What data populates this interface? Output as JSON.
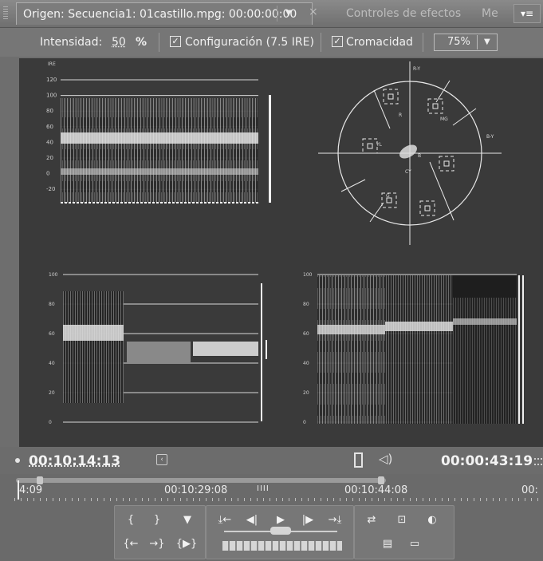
{
  "tabs": {
    "source": "Origen: Secuencia1: 01castillo.mpg: 00:00:00:00",
    "effects": "Controles de efectos",
    "meta": "Me",
    "dropdown_glyph": "▼",
    "close_glyph": "×",
    "panel_menu_glyph": "▾≡"
  },
  "options": {
    "intensity_label": "Intensidad:",
    "intensity_value": "50",
    "intensity_unit": "%",
    "setup_label": "Configuración (7.5 IRE)",
    "setup_checked": true,
    "chroma_label": "Cromacidad",
    "chroma_checked": true,
    "zoom_value": "75%"
  },
  "scopes": {
    "waveform_axis_title": "IRE",
    "waveform_ticks": [
      "120",
      "100",
      "80",
      "60",
      "40",
      "20",
      "0",
      "-20"
    ],
    "vector_labels": {
      "ry": "R-Y",
      "by": "B-Y",
      "r": "R",
      "mg": "MG",
      "yl": "YL",
      "g": "G",
      "cy": "CY",
      "b": "B"
    },
    "parade_ticks": [
      "100",
      "80",
      "60",
      "40",
      "20",
      "0"
    ]
  },
  "timecode": {
    "current": "00:10:14:13",
    "duration": "00:00:43:19"
  },
  "ruler": {
    "labels": [
      "4:09",
      "00:10:29:08",
      "00:10:44:08",
      "00:"
    ]
  },
  "controls": {
    "mark_in": "{",
    "mark_out": "}",
    "set_marker": "▼",
    "goto_in": "{←",
    "goto_out": "→}",
    "play_in_out": "{▶}",
    "insert": "⤓←",
    "step_back": "◀|",
    "play": "▶",
    "step_fwd": "|▶",
    "overlay": "→⤓",
    "loop": "⇄",
    "safe_margins": "⊡",
    "output": "◐",
    "export_frame": "▤",
    "trim": "▭"
  }
}
